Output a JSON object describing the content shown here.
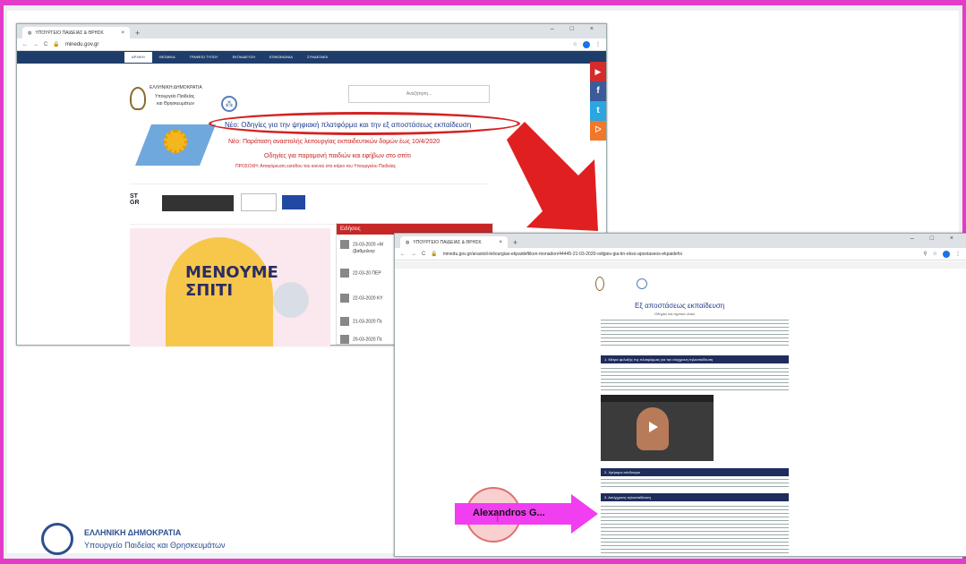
{
  "win1": {
    "tab_title": "ΥΠΟΥΡΓΕΙΟ ΠΑΙΔΕΙΑΣ & ΘΡΗΣΚ",
    "url": "minedu.gov.gr",
    "nav": [
      "ΑΡΧΙΚΗ",
      "ΘΕΣΜΙΚΑ",
      "ΓΡΑΦΕΙΟ ΤΥΠΟΥ",
      "ΕΚΠΑΙΔΕΥΣΗ",
      "ΕΠΙΚΟΙΝΩΝΙΑ",
      "ΣΥΝΔΕΣΜΟΙ"
    ],
    "logo_line1": "ΕΛΛΗΝΙΚΗ ΔΗΜΟΚΡΑΤΙΑ",
    "logo_line2": "Υπουργείο Παιδείας",
    "logo_line3": "και Θρησκευμάτων",
    "search_placeholder": "Αναζήτηση...",
    "headline1": "Νέο: Οδηγίες για την ψηφιακή πλατφόρμα και την εξ αποστάσεως εκπαίδευση",
    "headline2": "Νέο: Παράταση αναστολής λειτουργίας εκπαιδευτικών δομών έως 10/4/2020",
    "headline3": "Οδηγίες για παραμονή παιδιών και εφήβων στο σπίτι",
    "headline4": "ΠΡΟΣΟΧΗ: Απαγόρευση εισόδου του κοινού στο κτίριο του Υπουργείου Παιδείας",
    "news_header": "Ειδήσεις",
    "news": [
      "23-03-2020 «Μ",
      "(βαθμολογι",
      "22-03-20 ΠΕΡ",
      "22-03-2020 ΚΥ",
      "21-03-2020 Πε",
      "20-03-2020 Πε"
    ],
    "poster_text": "ΜΕΝΟΥΜΕ ΣΠΙΤΙ"
  },
  "win2": {
    "tab_title": "ΥΠΟΥΡΓΕΙΟ ΠΑΙΔΕΙΑΣ & ΘΡΗΣΚ",
    "url": "minedu.gov.gr/anastoli-leitourgias-ekpaideftikon-monadon/44445-21-03-2020-odigies-gia-tin-ekso-apostaseos-ekpaidefsi",
    "page_title": "Εξ αποστάσεως εκπαίδευση",
    "page_subtitle": "Οδηγίες και σχετικό υλικό",
    "section1": "1. Μέτρα φύλαξης της πλατφόρμας για την σύγχρονη τηλεκπαίδευση",
    "section2": "2. Χρήσιμοι σύνδεσμοι",
    "section3": "3. Ασύγχρονη τηλεκπαίδευση"
  },
  "cursor_label": "Alexandros G...",
  "footer": {
    "line1": "ΕΛΛΗΝΙΚΗ ΔΗΜΟΚΡΑΤΙΑ",
    "line2": "Υπουργείο Παιδείας και Θρησκευμάτων"
  }
}
